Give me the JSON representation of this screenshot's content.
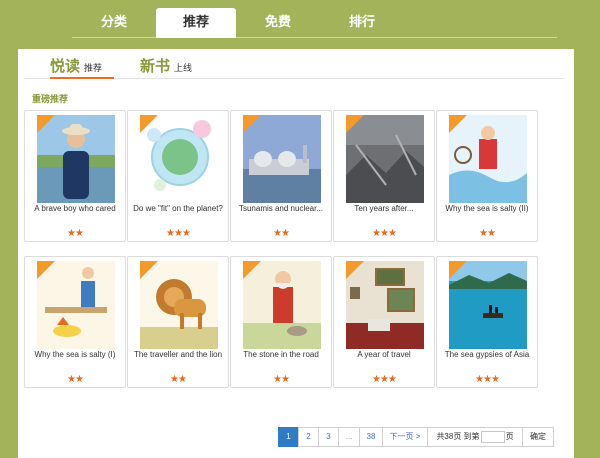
{
  "top_tabs": [
    {
      "label": "分类"
    },
    {
      "label": "推荐"
    },
    {
      "label": "免费"
    },
    {
      "label": "排行"
    }
  ],
  "sub_tabs": [
    {
      "big": "悦读",
      "small": "推荐"
    },
    {
      "big": "新书",
      "small": "上线"
    }
  ],
  "section_title": "重磅推荐",
  "books": [
    {
      "title": "A brave boy who cared",
      "stars": "★★",
      "rating": 2
    },
    {
      "title": "Do we \"fit\" on the planet?",
      "stars": "★★★",
      "rating": 3
    },
    {
      "title": "Tsunamis and nuclear...",
      "stars": "★★",
      "rating": 2
    },
    {
      "title": "Ten years after...",
      "stars": "★★★",
      "rating": 3
    },
    {
      "title": "Why the sea is salty (II)",
      "stars": "★★",
      "rating": 2
    },
    {
      "title": "Why the sea is salty (I)",
      "stars": "★★",
      "rating": 2
    },
    {
      "title": "The traveller and the lion",
      "stars": "★★",
      "rating": 2
    },
    {
      "title": "The stone in the road",
      "stars": "★★",
      "rating": 2
    },
    {
      "title": "A year of travel",
      "stars": "★★★",
      "rating": 3
    },
    {
      "title": "The sea gypsies of Asia",
      "stars": "★★★",
      "rating": 3
    }
  ],
  "pager": {
    "pages": [
      "1",
      "2",
      "3",
      "...",
      "38"
    ],
    "current": "1",
    "next": "下一页 >",
    "total_prefix": "共38页 到第",
    "total_suffix": "页",
    "confirm": "确定"
  },
  "colors": {
    "background": "#a3b35a",
    "accent": "#8a9a3c",
    "star": "#e86a1e",
    "pager_active": "#2f7cc6"
  }
}
